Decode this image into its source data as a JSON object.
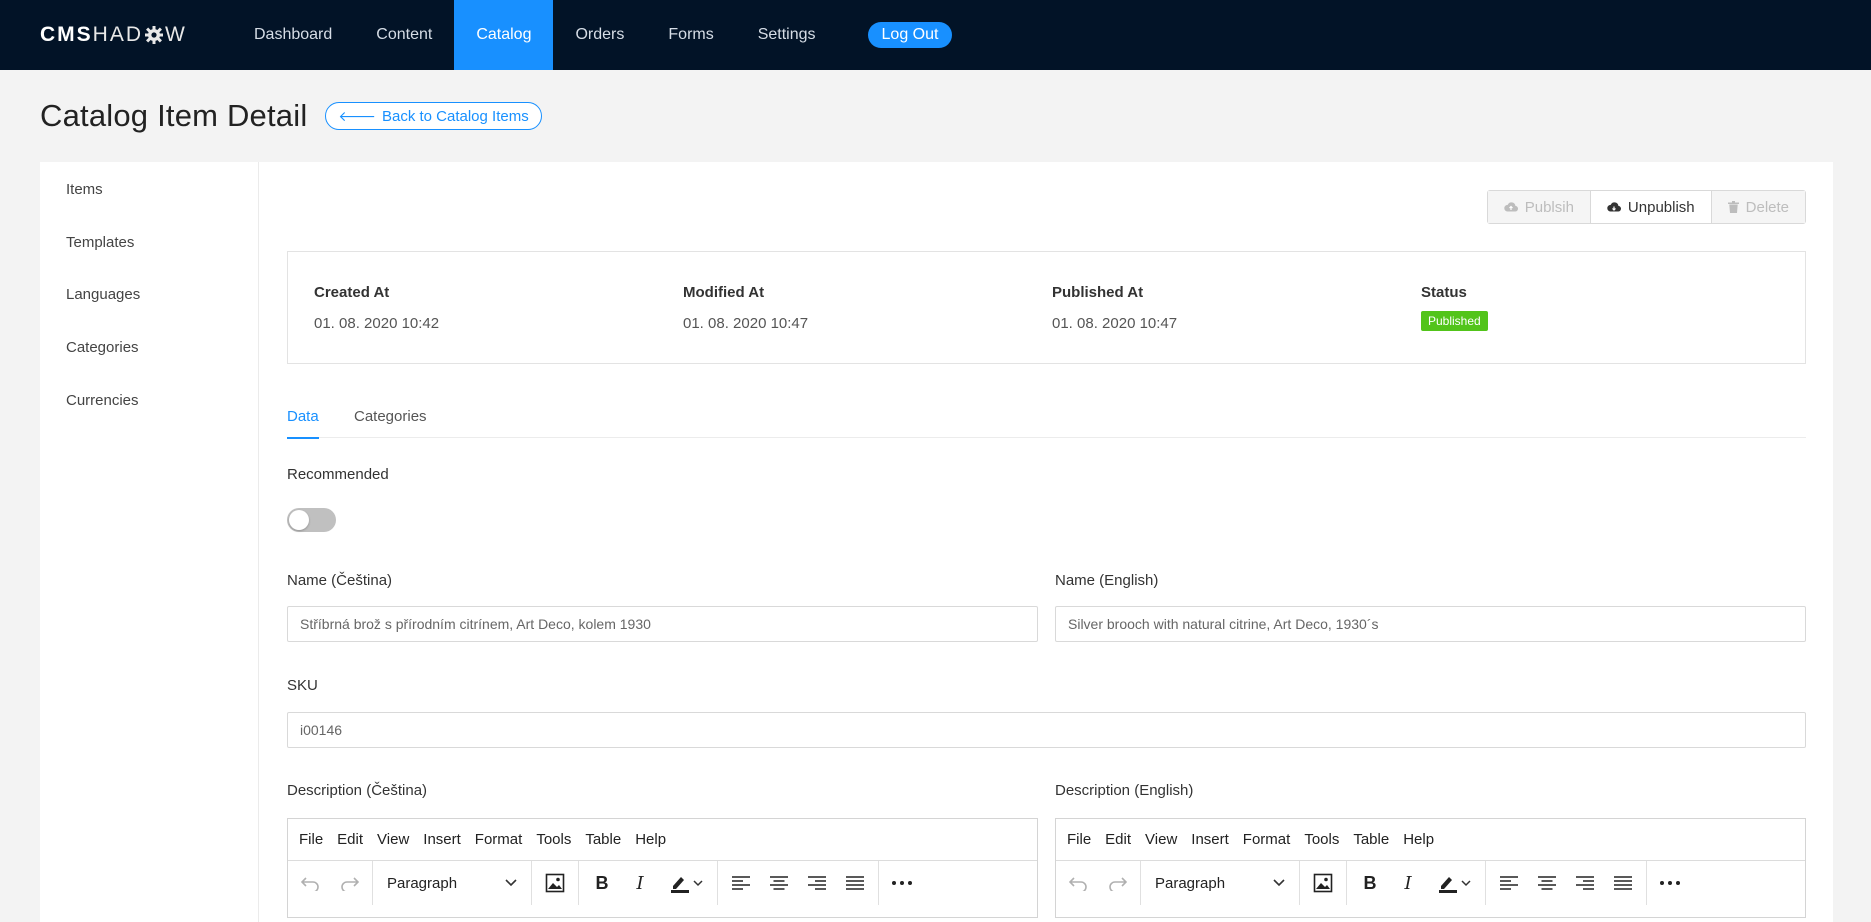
{
  "nav": {
    "logo_bold": "CMS",
    "logo_light_1": "HAD",
    "logo_light_2": "W",
    "items": [
      {
        "label": "Dashboard"
      },
      {
        "label": "Content"
      },
      {
        "label": "Catalog"
      },
      {
        "label": "Orders"
      },
      {
        "label": "Forms"
      },
      {
        "label": "Settings"
      }
    ],
    "active": "Catalog",
    "logout_label": "Log Out"
  },
  "page": {
    "title": "Catalog Item Detail",
    "back_label": "Back to Catalog Items"
  },
  "sidebar": {
    "items": [
      {
        "label": "Items"
      },
      {
        "label": "Templates"
      },
      {
        "label": "Languages"
      },
      {
        "label": "Categories"
      },
      {
        "label": "Currencies"
      }
    ]
  },
  "actions": {
    "publish_label": "Publsih",
    "unpublish_label": "Unpublish",
    "delete_label": "Delete"
  },
  "info": {
    "created_label": "Created At",
    "created_value": "01. 08. 2020 10:42",
    "modified_label": "Modified At",
    "modified_value": "01. 08. 2020 10:47",
    "published_label": "Published At",
    "published_value": "01. 08. 2020 10:47",
    "status_label": "Status",
    "status_value": "Published",
    "status_color": "#52c41a"
  },
  "tabs": [
    {
      "label": "Data",
      "active": true
    },
    {
      "label": "Categories",
      "active": false
    }
  ],
  "form": {
    "recommended_label": "Recommended",
    "recommended_on": false,
    "name_cs_label": "Name (Čeština)",
    "name_cs_value": "Stříbrná brož s přírodním citrínem, Art Deco, kolem 1930",
    "name_en_label": "Name (English)",
    "name_en_value": "Silver brooch with natural citrine, Art Deco, 1930´s",
    "sku_label": "SKU",
    "sku_value": "i00146",
    "desc_cs_label": "Description (Čeština)",
    "desc_en_label": "Description (English)"
  },
  "editor": {
    "menu": [
      "File",
      "Edit",
      "View",
      "Insert",
      "Format",
      "Tools",
      "Table",
      "Help"
    ],
    "block_format": "Paragraph",
    "icons": [
      "undo-icon",
      "redo-icon",
      "image-icon",
      "bold-icon",
      "italic-icon",
      "highlight-icon",
      "align-left-icon",
      "align-center-icon",
      "align-right-icon",
      "align-justify-icon",
      "more-icon"
    ]
  },
  "colors": {
    "nav_bg": "#021327",
    "accent": "#1890ff",
    "success": "#52c41a"
  }
}
